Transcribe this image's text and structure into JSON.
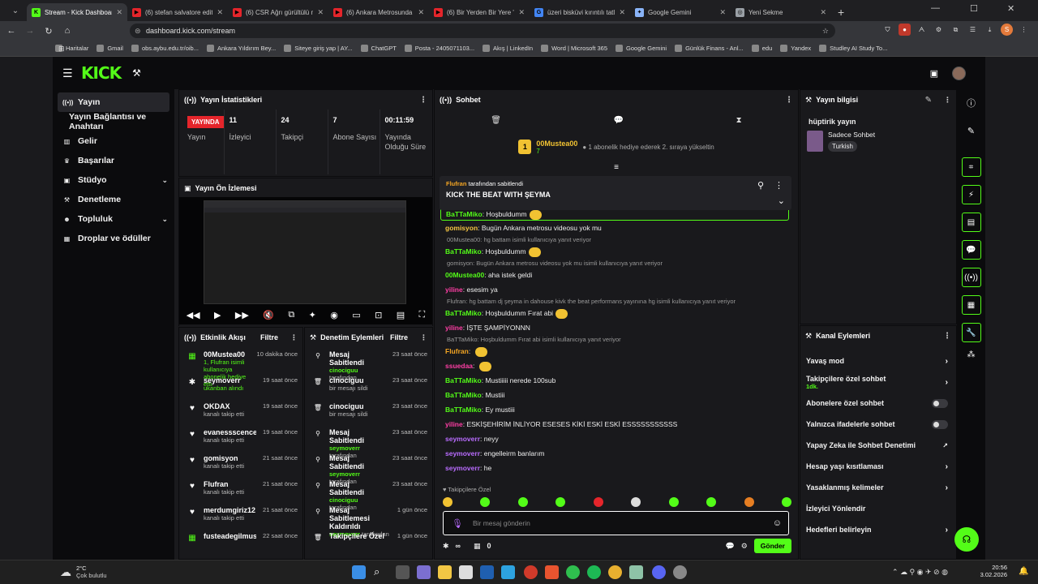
{
  "browser": {
    "tabs": [
      {
        "title": "Stream - Kick Dashboard",
        "color": "#53fc18",
        "icon": "K",
        "active": true
      },
      {
        "title": "(6) stefan salvatore edit -",
        "color": "#e5252b",
        "icon": "▶"
      },
      {
        "title": "(6) CSR Ağrı gürültülü m",
        "color": "#e5252b",
        "icon": "▶"
      },
      {
        "title": "(6) Ankara Metrosunda O",
        "color": "#e5252b",
        "icon": "▶"
      },
      {
        "title": "(6) Bir Yerden Bir Yere \"An",
        "color": "#e5252b",
        "icon": "▶"
      },
      {
        "title": "üzeri bisküvi kırıntılı tatlı",
        "color": "#4285f4",
        "icon": "G"
      },
      {
        "title": "Google Gemini",
        "color": "#8ab4f8",
        "icon": "✦"
      },
      {
        "title": "Yeni Sekme",
        "color": "#9aa0a6",
        "icon": "◎"
      }
    ],
    "url": "dashboard.kick.com/stream",
    "bookmarks": [
      "Haritalar",
      "Gmail",
      "obs.aybu.edu.tr/oib...",
      "Ankara Yıldırım Bey...",
      "Siteye giriş yap | AY...",
      "ChatGPT",
      "Posta - 2405071103...",
      "Akış | LinkedIn",
      "Word | Microsoft 365",
      "Google Gemini",
      "Günlük Finans - Anl...",
      "edu",
      "Yandex",
      "Studley AI Study To..."
    ]
  },
  "sidebar": {
    "items": [
      {
        "label": "Yayın",
        "icon": "broadcast-icon",
        "glyph": "((•))",
        "active": true
      },
      {
        "label": "Yayın Bağlantısı ve Anahtarı",
        "icon": "",
        "glyph": ""
      },
      {
        "label": "Gelir",
        "icon": "chart-icon",
        "glyph": "▥"
      },
      {
        "label": "Başarılar",
        "icon": "trophy-icon",
        "glyph": "♛"
      },
      {
        "label": "Stüdyo",
        "icon": "studio-icon",
        "glyph": "▣",
        "chevron": true
      },
      {
        "label": "Denetleme",
        "icon": "hammer-icon",
        "glyph": "⚒"
      },
      {
        "label": "Topluluk",
        "icon": "community-icon",
        "glyph": "☻",
        "chevron": true
      },
      {
        "label": "Droplar ve ödüller",
        "icon": "gift-icon",
        "glyph": "▦"
      }
    ]
  },
  "stats": {
    "title": "Yayın İstatistikleri",
    "live_badge": "YAYINDA",
    "live_label": "Yayın",
    "items": [
      {
        "value": "11",
        "label": "İzleyici"
      },
      {
        "value": "24",
        "label": "Takipçi"
      },
      {
        "value": "7",
        "label": "Abone Sayısı"
      },
      {
        "value": "00:11:59",
        "label": "Yayında Olduğu Süre"
      }
    ]
  },
  "preview": {
    "title": "Yayın Ön İzlemesi"
  },
  "activity": {
    "title": "Etkinlik Akışı",
    "filter": "Filtre",
    "items": [
      {
        "name": "00Mustea00",
        "time": "10 dakika önce",
        "desc": "1, Flufran isimli kullanıcıya abonelik hediye etti.",
        "icon": "gift-icon",
        "glyph": "▦"
      },
      {
        "name": "seymoverr",
        "time": "19 saat önce",
        "desc": "ukanban alındı",
        "icon": "raid-icon",
        "glyph": "✱"
      },
      {
        "name": "OKDAX",
        "time": "19 saat önce",
        "desc": "kanalı takip etti",
        "icon": "heart-icon",
        "glyph": "♥"
      },
      {
        "name": "evanessscence_e",
        "time": "19 saat önce",
        "desc": "kanalı takip etti",
        "icon": "heart-icon",
        "glyph": "♥"
      },
      {
        "name": "gomisyon",
        "time": "21 saat önce",
        "desc": "kanalı takip etti",
        "icon": "heart-icon",
        "glyph": "♥"
      },
      {
        "name": "Flufran",
        "time": "21 saat önce",
        "desc": "kanalı takip etti",
        "icon": "heart-icon",
        "glyph": "♥"
      },
      {
        "name": "merdumgiriz12",
        "time": "21 saat önce",
        "desc": "kanalı takip etti",
        "icon": "heart-icon",
        "glyph": "♥"
      },
      {
        "name": "fusteadegilmustea",
        "time": "22 saat önce",
        "desc": "",
        "icon": "gift-icon",
        "glyph": "▦"
      }
    ]
  },
  "modlog": {
    "title": "Denetim Eylemleri",
    "filter": "Filtre",
    "items": [
      {
        "name": "Mesaj Sabitlendi",
        "time": "23 saat önce",
        "by": "cinociguu",
        "suffix": " tarafından",
        "icon": "pin-icon",
        "glyph": "⚲"
      },
      {
        "name": "cinociguu",
        "time": "23 saat önce",
        "desc": "bir mesajı sildi",
        "icon": "trash-icon",
        "glyph": "🗑"
      },
      {
        "name": "cinociguu",
        "time": "23 saat önce",
        "desc": "bir mesajı sildi",
        "icon": "trash-icon",
        "glyph": "🗑"
      },
      {
        "name": "Mesaj Sabitlendi",
        "time": "23 saat önce",
        "by": "seymoverr",
        "suffix": " tarafından",
        "icon": "pin-icon",
        "glyph": "⚲"
      },
      {
        "name": "Mesaj Sabitlendi",
        "time": "23 saat önce",
        "by": "seymoverr",
        "suffix": " tarafından",
        "icon": "pin-icon",
        "glyph": "⚲"
      },
      {
        "name": "Mesaj Sabitlendi",
        "time": "23 saat önce",
        "by": "cinociguu",
        "suffix": " tarafından",
        "icon": "pin-icon",
        "glyph": "⚲"
      },
      {
        "name": "Mesaj Sabitlemesi Kaldırıldı",
        "time": "1 gün önce",
        "by": "seymoverr",
        "suffix": " tarafından",
        "icon": "unpin-icon",
        "glyph": "⚲"
      },
      {
        "name": "Takipçilere Özel",
        "time": "1 gün önce",
        "desc": "",
        "icon": "trash-icon",
        "glyph": "🗑"
      }
    ]
  },
  "chat": {
    "title": "Sohbet",
    "gift_user": "00Mustea00",
    "gift_count": "7",
    "gift_text": "1 abonelik hediye ederek 2. sıraya yükseltin",
    "pinned_by": "Flufran",
    "pinned_suffix": " tarafından sabitlendi",
    "pinned_text": "KICK THE BEAT WITH ŞEYMA",
    "messages": [
      {
        "user": "BaTTaMiko",
        "color": "#53fc18",
        "text": "Hoşbuldumm",
        "emote": true
      },
      {
        "user": "gomisyon",
        "color": "#f5c542",
        "text": "Bugün Ankara metrosu videosu yok mu"
      },
      {
        "reply": "00Mustea00: hg battam isimli kullanıcıya yanıt veriyor"
      },
      {
        "user": "BaTTaMiko",
        "color": "#53fc18",
        "text": "Hoşbuldumm",
        "emote": true
      },
      {
        "reply": "gomisyon: Bugün Ankara metrosu videosu yok mu isimli kullanıcıya yanıt veriyor"
      },
      {
        "user": "00Mustea00",
        "color": "#53fc18",
        "text": "aha istek geldi"
      },
      {
        "user": "yiline",
        "color": "#ff3ea5",
        "text": "esesim ya"
      },
      {
        "reply": "Flufran: hg battam dj şeyma in dahouse kivk the beat performans yayınına hg isimli kullanıcıya yanıt veriyor"
      },
      {
        "user": "BaTTaMiko",
        "color": "#53fc18",
        "text": "Hoşbuldumm Fırat abi",
        "emote": true
      },
      {
        "user": "yiline",
        "color": "#ff3ea5",
        "text": "İŞTE ŞAMPİYONNN"
      },
      {
        "reply": "BaTTaMiko: Hoşbuldumm Fırat abi isimli kullanıcıya yanıt veriyor"
      },
      {
        "user": "Flufran",
        "color": "#f5a623",
        "text": "",
        "emote": true
      },
      {
        "user": "ssuedaa",
        "color": "#ff3ea5",
        "text": "",
        "emote": true
      },
      {
        "user": "BaTTaMiko",
        "color": "#53fc18",
        "text": "Mustiiiii nerede 100sub"
      },
      {
        "user": "BaTTaMiko",
        "color": "#53fc18",
        "text": "Mustiii"
      },
      {
        "user": "BaTTaMiko",
        "color": "#53fc18",
        "text": "Ey mustiii"
      },
      {
        "user": "yiline",
        "color": "#ff3ea5",
        "text": "ESKİŞEHİRİM İNLİYOR ESESES KİKİ ESKİ ESKİ ESSSSSSSSSSS"
      },
      {
        "user": "seymoverr",
        "color": "#b96cff",
        "text": "neyy"
      },
      {
        "user": "seymoverr",
        "color": "#b96cff",
        "text": "engelleirm banlarım"
      },
      {
        "user": "seymoverr",
        "color": "#b96cff",
        "text": "he"
      }
    ],
    "followers_only": "Takipçilere Özel",
    "placeholder": "Bir mesaj gönderin",
    "viewers_inf": "∞",
    "gift_zero": "0",
    "send": "Gönder"
  },
  "streaminfo": {
    "title": "Yayın bilgisi",
    "stream_title": "hüptirik yayın",
    "category": "Sadece Sohbet",
    "language": "Turkish"
  },
  "channel_actions": {
    "title": "Kanal Eylemleri",
    "items": [
      {
        "label": "Yavaş mod",
        "type": "chevron"
      },
      {
        "label": "Takipçilere özel sohbet",
        "sub": "1dk.",
        "type": "chevron"
      },
      {
        "label": "Abonelere özel sohbet",
        "type": "toggle"
      },
      {
        "label": "Yalnızca ifadelerle sohbet",
        "type": "toggle"
      },
      {
        "label": "Yapay Zeka ile Sohbet Denetimi",
        "type": "external"
      },
      {
        "label": "Hesap yaşı kısıtlaması",
        "type": "chevron"
      },
      {
        "label": "Yasaklanmış kelimeler",
        "type": "chevron"
      },
      {
        "label": "İzleyici Yönlendir",
        "type": "none"
      },
      {
        "label": "Hedefleri belirleyin",
        "type": "chevron"
      }
    ]
  },
  "taskbar": {
    "weather_temp": "2°C",
    "weather_desc": "Çok bulutlu",
    "time": "20:56",
    "date": "3.02.2026"
  }
}
